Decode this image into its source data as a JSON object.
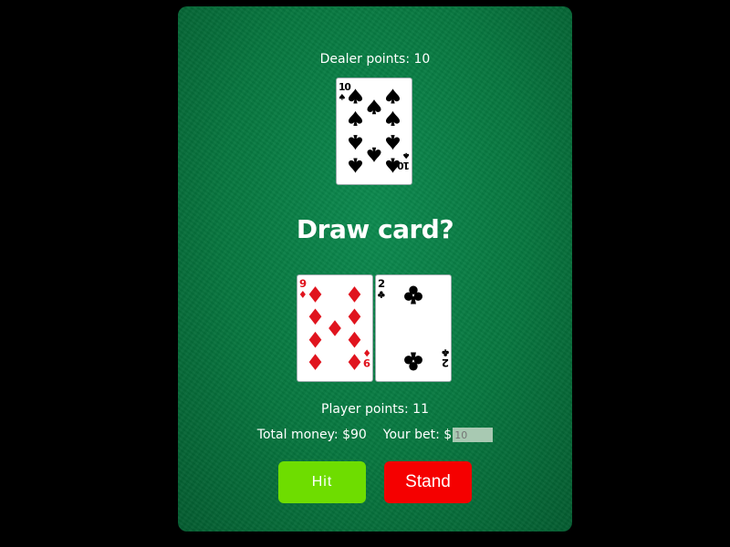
{
  "dealer": {
    "points_label": "Dealer points: 10",
    "cards": [
      {
        "rank": "10",
        "suit": "spades",
        "color": "#000000"
      }
    ]
  },
  "prompt": "Draw card?",
  "player": {
    "cards": [
      {
        "rank": "9",
        "suit": "diamonds",
        "color": "#e0141e"
      },
      {
        "rank": "2",
        "suit": "clubs",
        "color": "#000000"
      }
    ],
    "points_label": "Player points: 11"
  },
  "money": {
    "total_label": "Total money: $90",
    "bet_label": "Your bet: $",
    "bet_placeholder": "10"
  },
  "buttons": {
    "hit": "Hit",
    "stand": "Stand"
  },
  "colors": {
    "felt": "#07773f",
    "hit": "#6edd00",
    "stand": "#f50000"
  }
}
